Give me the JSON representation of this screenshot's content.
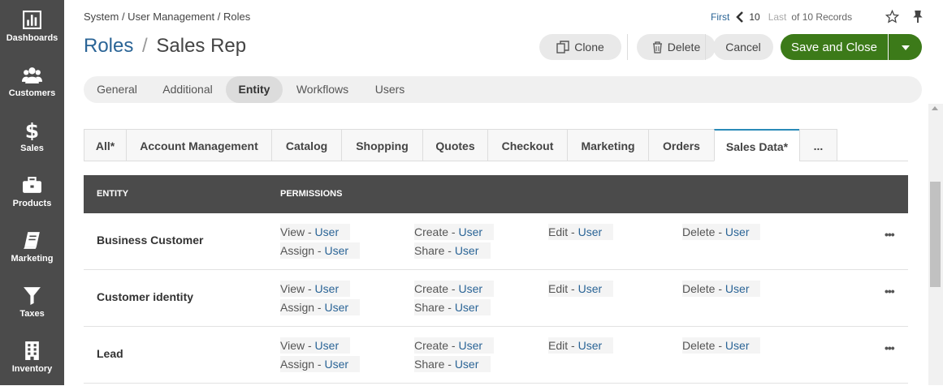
{
  "sidebar": {
    "items": [
      {
        "label": "Dashboards",
        "icon": "dashboards-icon"
      },
      {
        "label": "Customers",
        "icon": "customers-icon"
      },
      {
        "label": "Sales",
        "icon": "dollar-icon"
      },
      {
        "label": "Products",
        "icon": "briefcase-icon"
      },
      {
        "label": "Marketing",
        "icon": "book-icon"
      },
      {
        "label": "Taxes",
        "icon": "filter-icon"
      },
      {
        "label": "Inventory",
        "icon": "building-icon"
      }
    ]
  },
  "breadcrumb": "System / User Management / Roles",
  "title": {
    "link": "Roles",
    "separator": "/",
    "name": "Sales Rep"
  },
  "pager": {
    "first": "First",
    "current": "10",
    "last": "Last",
    "of": "of 10 Records"
  },
  "actions": {
    "clone": "Clone",
    "delete": "Delete",
    "cancel": "Cancel",
    "save": "Save and Close"
  },
  "tabs": [
    "General",
    "Additional",
    "Entity",
    "Workflows",
    "Users"
  ],
  "active_tab": "Entity",
  "category_tabs": [
    "All*",
    "Account Management",
    "Catalog",
    "Shopping",
    "Quotes",
    "Checkout",
    "Marketing",
    "Orders",
    "Sales Data*",
    "..."
  ],
  "active_category": "Sales Data*",
  "table": {
    "headers": {
      "entity": "ENTITY",
      "permissions": "PERMISSIONS"
    },
    "rows": [
      {
        "name": "Business Customer",
        "perms": {
          "view": "View - ",
          "view_lvl": "User",
          "create": "Create - ",
          "create_lvl": "User",
          "edit": "Edit - ",
          "edit_lvl": "User",
          "delete": "Delete - ",
          "delete_lvl": "User",
          "assign": "Assign - ",
          "assign_lvl": "User",
          "share": "Share - ",
          "share_lvl": "User"
        }
      },
      {
        "name": "Customer identity",
        "perms": {
          "view": "View - ",
          "view_lvl": "User",
          "create": "Create - ",
          "create_lvl": "User",
          "edit": "Edit - ",
          "edit_lvl": "User",
          "delete": "Delete - ",
          "delete_lvl": "User",
          "assign": "Assign - ",
          "assign_lvl": "User",
          "share": "Share - ",
          "share_lvl": "User"
        }
      },
      {
        "name": "Lead",
        "perms": {
          "view": "View - ",
          "view_lvl": "User",
          "create": "Create - ",
          "create_lvl": "User",
          "edit": "Edit - ",
          "edit_lvl": "User",
          "delete": "Delete - ",
          "delete_lvl": "User",
          "assign": "Assign - ",
          "assign_lvl": "User",
          "share": "Share - ",
          "share_lvl": "User"
        }
      }
    ],
    "row_menu": "•••"
  },
  "colors": {
    "sidebar": "#4b4b4b",
    "accent_link": "#2a6496",
    "save": "#3c7a19",
    "table_header": "#4b4b4b"
  }
}
